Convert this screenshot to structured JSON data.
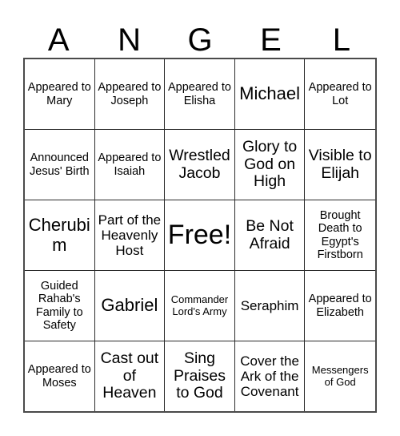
{
  "card": {
    "title_letters": [
      "A",
      "N",
      "G",
      "E",
      "L"
    ],
    "grid_border_color": "#2b2b2b",
    "background_color": "#ffffff",
    "text_color": "#000000",
    "rows": 5,
    "columns": 5
  },
  "grid": {
    "rows": [
      {
        "cells": [
          {
            "text": "Appeared to Mary",
            "size": "ts-sm"
          },
          {
            "text": "Appeared to Joseph",
            "size": "ts-sm"
          },
          {
            "text": "Appeared to Elisha",
            "size": "ts-sm"
          },
          {
            "text": "Michael",
            "size": "ts-xl"
          },
          {
            "text": "Appeared to Lot",
            "size": "ts-sm"
          }
        ]
      },
      {
        "cells": [
          {
            "text": "Announced Jesus' Birth",
            "size": "ts-sm"
          },
          {
            "text": "Appeared to Isaiah",
            "size": "ts-sm"
          },
          {
            "text": "Wrestled Jacob",
            "size": "ts-lg"
          },
          {
            "text": "Glory to God on High",
            "size": "ts-lg"
          },
          {
            "text": "Visible to Elijah",
            "size": "ts-lg"
          }
        ]
      },
      {
        "cells": [
          {
            "text": "Cherubim",
            "size": "ts-xl"
          },
          {
            "text": "Part of the Heavenly Host",
            "size": "ts-md"
          },
          {
            "text": "Free!",
            "size": "ts-xxl"
          },
          {
            "text": "Be Not Afraid",
            "size": "ts-lg"
          },
          {
            "text": "Brought Death to Egypt's Firstborn",
            "size": "ts-sm"
          }
        ]
      },
      {
        "cells": [
          {
            "text": "Guided Rahab's Family to Safety",
            "size": "ts-sm"
          },
          {
            "text": "Gabriel",
            "size": "ts-xl"
          },
          {
            "text": "Commander Lord's Army",
            "size": "ts-xs"
          },
          {
            "text": "Seraphim",
            "size": "ts-md"
          },
          {
            "text": "Appeared to Elizabeth",
            "size": "ts-sm"
          }
        ]
      },
      {
        "cells": [
          {
            "text": "Appeared to Moses",
            "size": "ts-sm"
          },
          {
            "text": "Cast out of Heaven",
            "size": "ts-lg"
          },
          {
            "text": "Sing Praises to God",
            "size": "ts-lg"
          },
          {
            "text": "Cover the Ark of the Covenant",
            "size": "ts-md"
          },
          {
            "text": "Messengers of God",
            "size": "ts-xs"
          }
        ]
      }
    ]
  }
}
